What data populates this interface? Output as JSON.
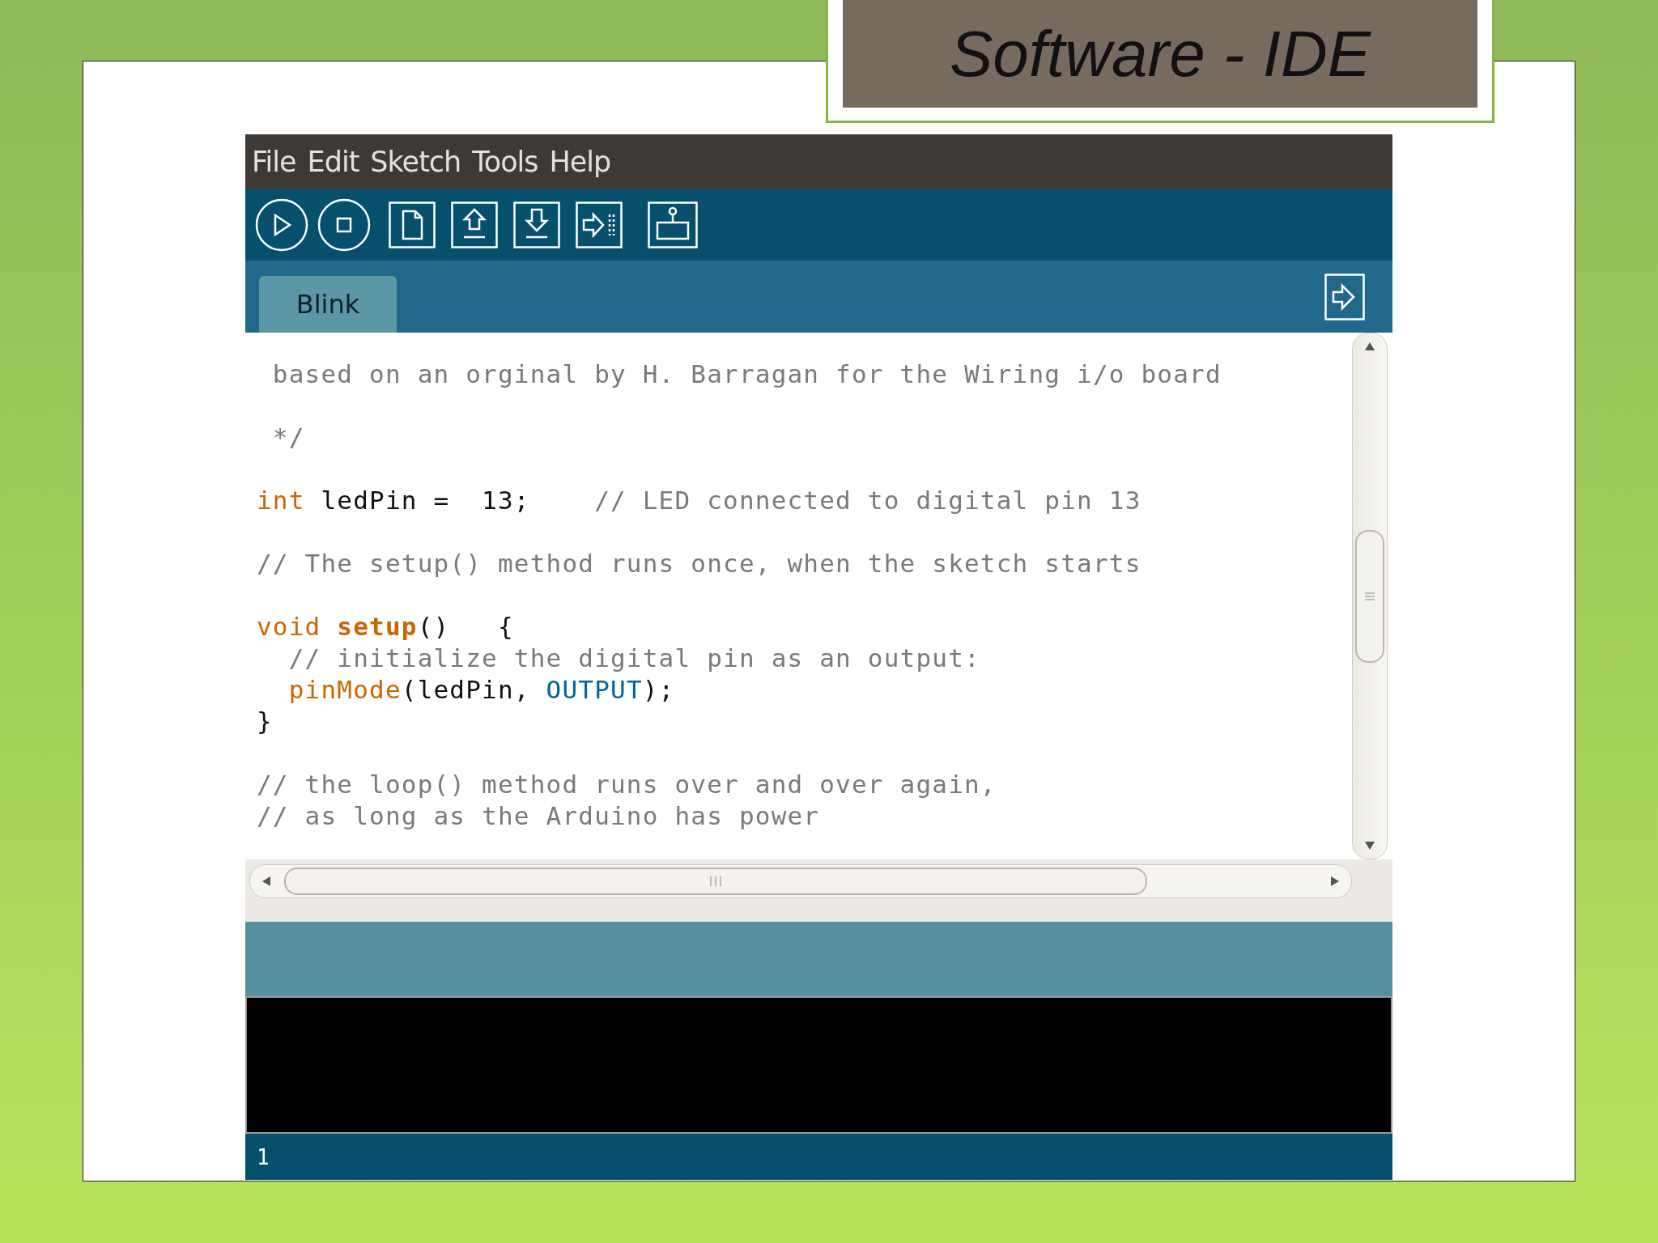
{
  "slide": {
    "title": "Software - IDE"
  },
  "ide": {
    "menu": [
      "File",
      "Edit",
      "Sketch",
      "Tools",
      "Help"
    ],
    "tabs": [
      {
        "label": "Blink",
        "selected": true
      }
    ],
    "code_blocks": [
      [
        {
          "tokens": [
            {
              "kind": "comment",
              "text": " based on an orginal by H. Barragan for the Wiring i/o board"
            }
          ]
        }
      ],
      [
        {
          "tokens": [
            {
              "kind": "comment",
              "text": " */"
            }
          ]
        }
      ],
      [
        {
          "tokens": [
            {
              "kind": "keyword",
              "text": "int"
            },
            {
              "kind": "plain",
              "text": " ledPin =  13;"
            },
            {
              "kind": "comment",
              "text": "    // LED connected to digital pin 13"
            }
          ]
        }
      ],
      [
        {
          "tokens": [
            {
              "kind": "comment",
              "text": "// The setup() method runs once, when the sketch starts"
            }
          ]
        }
      ],
      [
        {
          "tokens": [
            {
              "kind": "keyword",
              "text": "void "
            },
            {
              "kind": "function_def",
              "text": "setup"
            },
            {
              "kind": "plain",
              "text": "()   {"
            }
          ]
        },
        {
          "tokens": [
            {
              "kind": "comment",
              "text": "  // initialize the digital pin as an output:"
            }
          ]
        },
        {
          "tokens": [
            {
              "kind": "function",
              "text": "  pinMode"
            },
            {
              "kind": "plain",
              "text": "(ledPin, "
            },
            {
              "kind": "constant",
              "text": "OUTPUT"
            },
            {
              "kind": "plain",
              "text": ");"
            }
          ]
        },
        {
          "tokens": [
            {
              "kind": "plain",
              "text": "}"
            }
          ]
        }
      ],
      [
        {
          "tokens": [
            {
              "kind": "comment",
              "text": "// the loop() method runs over and over again,"
            }
          ]
        },
        {
          "tokens": [
            {
              "kind": "comment",
              "text": "// as long as the Arduino has power"
            }
          ]
        }
      ]
    ],
    "status_bar": {
      "line": "1"
    }
  }
}
